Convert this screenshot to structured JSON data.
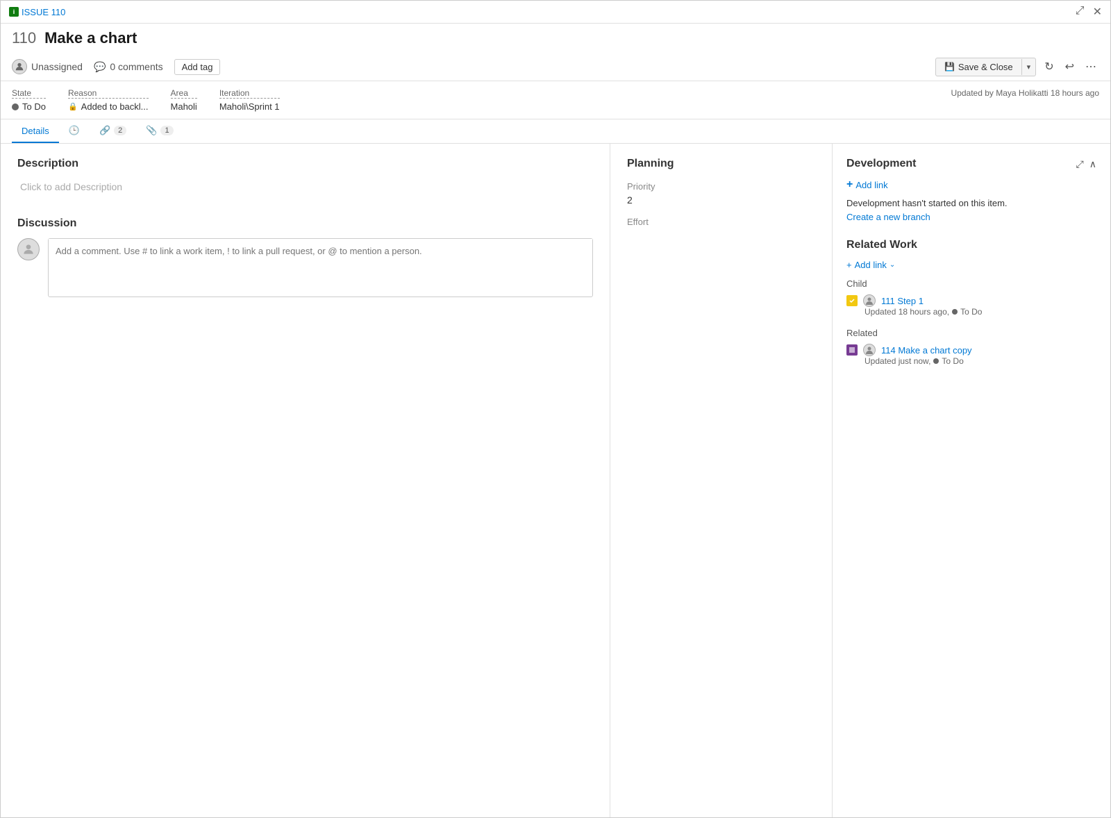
{
  "window": {
    "issue_link": "ISSUE 110",
    "issue_icon": "i",
    "title_number": "110",
    "title": "Make a chart",
    "controls": {
      "expand": "⤢",
      "close": "✕"
    }
  },
  "action_bar": {
    "assignee": "Unassigned",
    "comments_count": "0 comments",
    "add_tag_label": "Add tag",
    "save_close_label": "Save & Close",
    "save_icon": "💾",
    "dropdown_arrow": "▾",
    "refresh_icon": "↻",
    "undo_icon": "↩",
    "more_icon": "⋯"
  },
  "fields": {
    "state_label": "State",
    "state_value": "To Do",
    "reason_label": "Reason",
    "reason_value": "Added to backl...",
    "area_label": "Area",
    "area_value": "Maholi",
    "iteration_label": "Iteration",
    "iteration_value": "Maholi\\Sprint 1",
    "updated_info": "Updated by Maya Holikatti 18 hours ago"
  },
  "tabs": {
    "details_label": "Details",
    "history_label": "History",
    "links_label": "Links",
    "links_count": "2",
    "attachments_label": "Attachments",
    "attachments_count": "1"
  },
  "description": {
    "title": "Description",
    "placeholder": "Click to add Description"
  },
  "discussion": {
    "title": "Discussion",
    "comment_placeholder": "Add a comment. Use # to link a work item, ! to link a pull request, or @ to mention a person."
  },
  "planning": {
    "title": "Planning",
    "priority_label": "Priority",
    "priority_value": "2",
    "effort_label": "Effort",
    "effort_value": ""
  },
  "development": {
    "title": "Development",
    "add_link_label": "Add link",
    "dev_status_text": "Development hasn't started on this item.",
    "create_branch_label": "Create a new branch",
    "expand_icon": "⤢",
    "collapse_icon": "∧"
  },
  "related_work": {
    "title": "Related Work",
    "add_link_label": "Add link",
    "dropdown_arrow": "⌄",
    "child_label": "Child",
    "child_items": [
      {
        "id": "111",
        "title": "Step 1",
        "updated": "Updated 18 hours ago,",
        "status": "To Do",
        "type": "task"
      }
    ],
    "related_label": "Related",
    "related_items": [
      {
        "id": "114",
        "title": "Make a chart copy",
        "updated": "Updated just now,",
        "status": "To Do",
        "type": "feature"
      }
    ]
  }
}
